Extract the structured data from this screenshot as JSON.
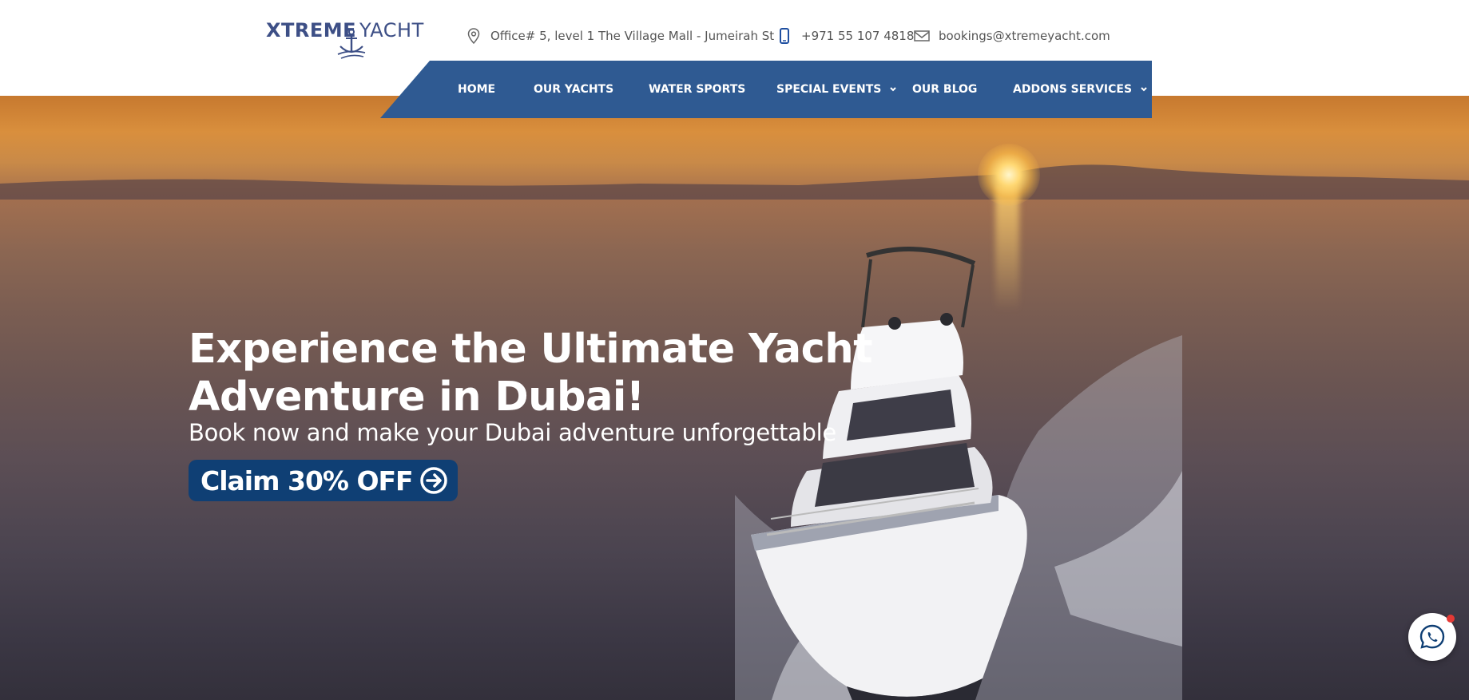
{
  "brand": {
    "name_bold": "XTREME",
    "name_light": "YACHT",
    "color": "#3d4f86"
  },
  "contact": {
    "address": "Office# 5, level 1 The Village Mall - Jumeirah St",
    "address_icon": "location-pin-icon",
    "phone": "+971 55 107 4818",
    "phone_icon": "mobile-phone-icon",
    "email": "bookings@xtremeyacht.com",
    "email_icon": "envelope-icon"
  },
  "nav": {
    "background": "#2f5a92",
    "items": [
      {
        "label": "HOME",
        "has_dropdown": false
      },
      {
        "label": "OUR YACHTS",
        "has_dropdown": false
      },
      {
        "label": "WATER SPORTS",
        "has_dropdown": false
      },
      {
        "label": "SPECIAL EVENTS",
        "has_dropdown": true
      },
      {
        "label": "OUR BLOG",
        "has_dropdown": false
      },
      {
        "label": "ADDONS SERVICES",
        "has_dropdown": true
      }
    ]
  },
  "hero": {
    "title_line1": "Experience the Ultimate Yacht",
    "title_line2": "Adventure in Dubai!",
    "subtitle": "Book now and make your Dubai adventure unforgettable",
    "cta_label": "Claim 30% OFF",
    "cta_icon": "arrow-right-circle-icon",
    "cta_color": "#0f3f74"
  },
  "floating": {
    "whatsapp_icon": "whatsapp-icon",
    "notification_color": "#e53935"
  }
}
